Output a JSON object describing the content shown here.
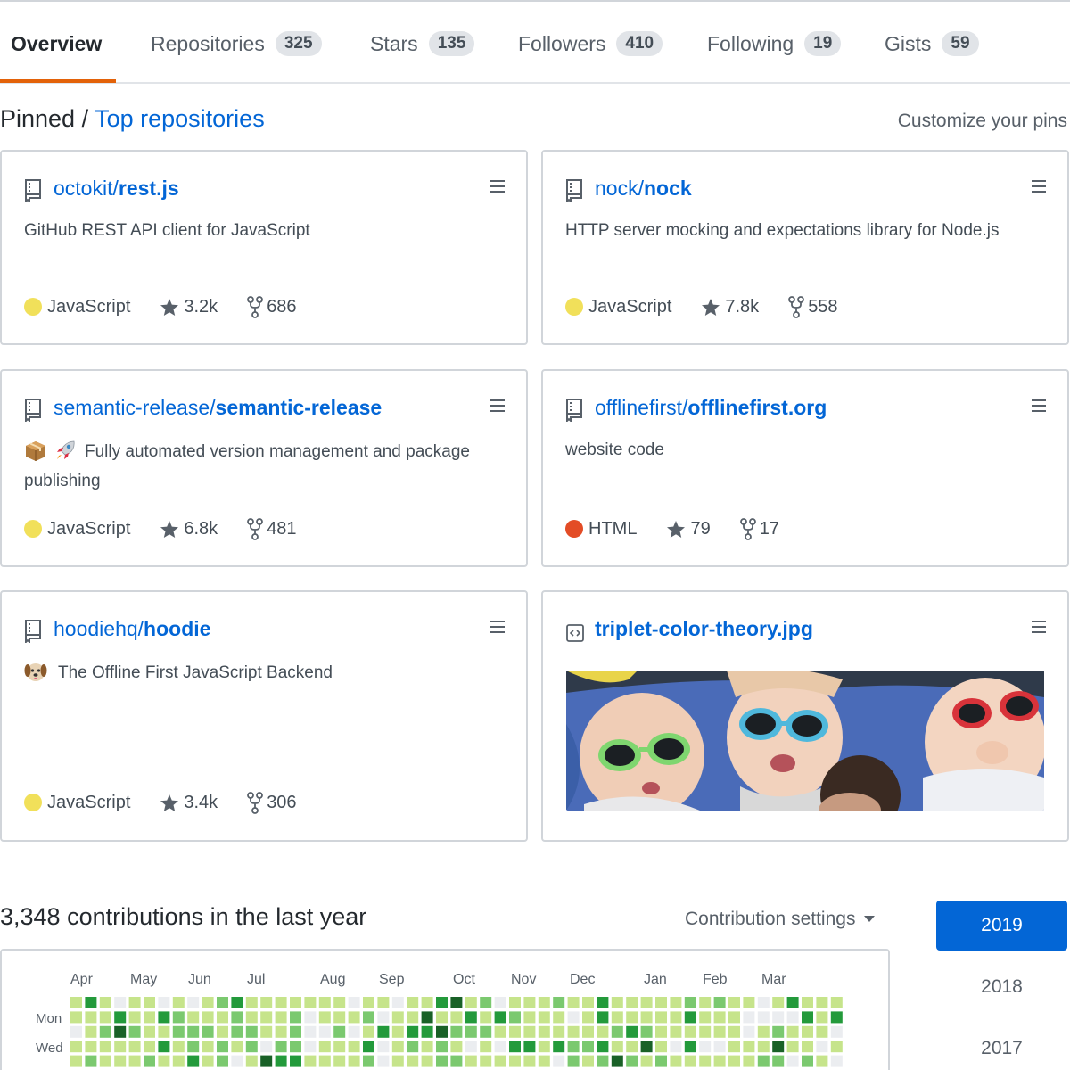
{
  "tabs": [
    {
      "label": "Overview",
      "count": null,
      "active": true
    },
    {
      "label": "Repositories",
      "count": "325"
    },
    {
      "label": "Stars",
      "count": "135"
    },
    {
      "label": "Followers",
      "count": "410"
    },
    {
      "label": "Following",
      "count": "19"
    },
    {
      "label": "Gists",
      "count": "59"
    }
  ],
  "pinned": {
    "prefix": "Pinned / ",
    "link": "Top repositories",
    "customize": "Customize your pins"
  },
  "repos": [
    {
      "owner": "octokit/",
      "name": "rest.js",
      "description": "GitHub REST API client for JavaScript",
      "language": "JavaScript",
      "lang_color": "#f1e05a",
      "stars": "3.2k",
      "forks": "686"
    },
    {
      "owner": "nock/",
      "name": "nock",
      "description": "HTTP server mocking and expectations library for Node.js",
      "language": "JavaScript",
      "lang_color": "#f1e05a",
      "stars": "7.8k",
      "forks": "558"
    },
    {
      "owner": "semantic-release/",
      "name": "semantic-release",
      "emoji": [
        "package-emoji",
        "rocket-emoji"
      ],
      "description": "Fully automated version management and package publishing",
      "language": "JavaScript",
      "lang_color": "#f1e05a",
      "stars": "6.8k",
      "forks": "481"
    },
    {
      "owner": "offlinefirst/",
      "name": "offlinefirst.org",
      "description": "website code",
      "language": "HTML",
      "lang_color": "#e34c26",
      "stars": "79",
      "forks": "17"
    },
    {
      "owner": "hoodiehq/",
      "name": "hoodie",
      "emoji": [
        "dog-emoji"
      ],
      "description": "The Offline First JavaScript Backend",
      "language": "JavaScript",
      "lang_color": "#f1e05a",
      "stars": "3.4k",
      "forks": "306"
    }
  ],
  "gist": {
    "name": "triplet-color-theory.jpg",
    "image": "photo of three babies wearing green, blue and red sunglasses"
  },
  "contributions": {
    "title": "3,348 contributions in the last year",
    "settings": "Contribution settings",
    "months": [
      "Apr",
      "May",
      "Jun",
      "Jul",
      "Aug",
      "Sep",
      "Oct",
      "Nov",
      "Dec",
      "Jan",
      "Feb",
      "Mar"
    ],
    "days": [
      "Mon",
      "Wed"
    ],
    "years": [
      "2019",
      "2018",
      "2017"
    ],
    "active_year": "2019",
    "colors": [
      "#ebedf0",
      "#c6e48b",
      "#7bc96f",
      "#239a3b",
      "#196127"
    ]
  }
}
